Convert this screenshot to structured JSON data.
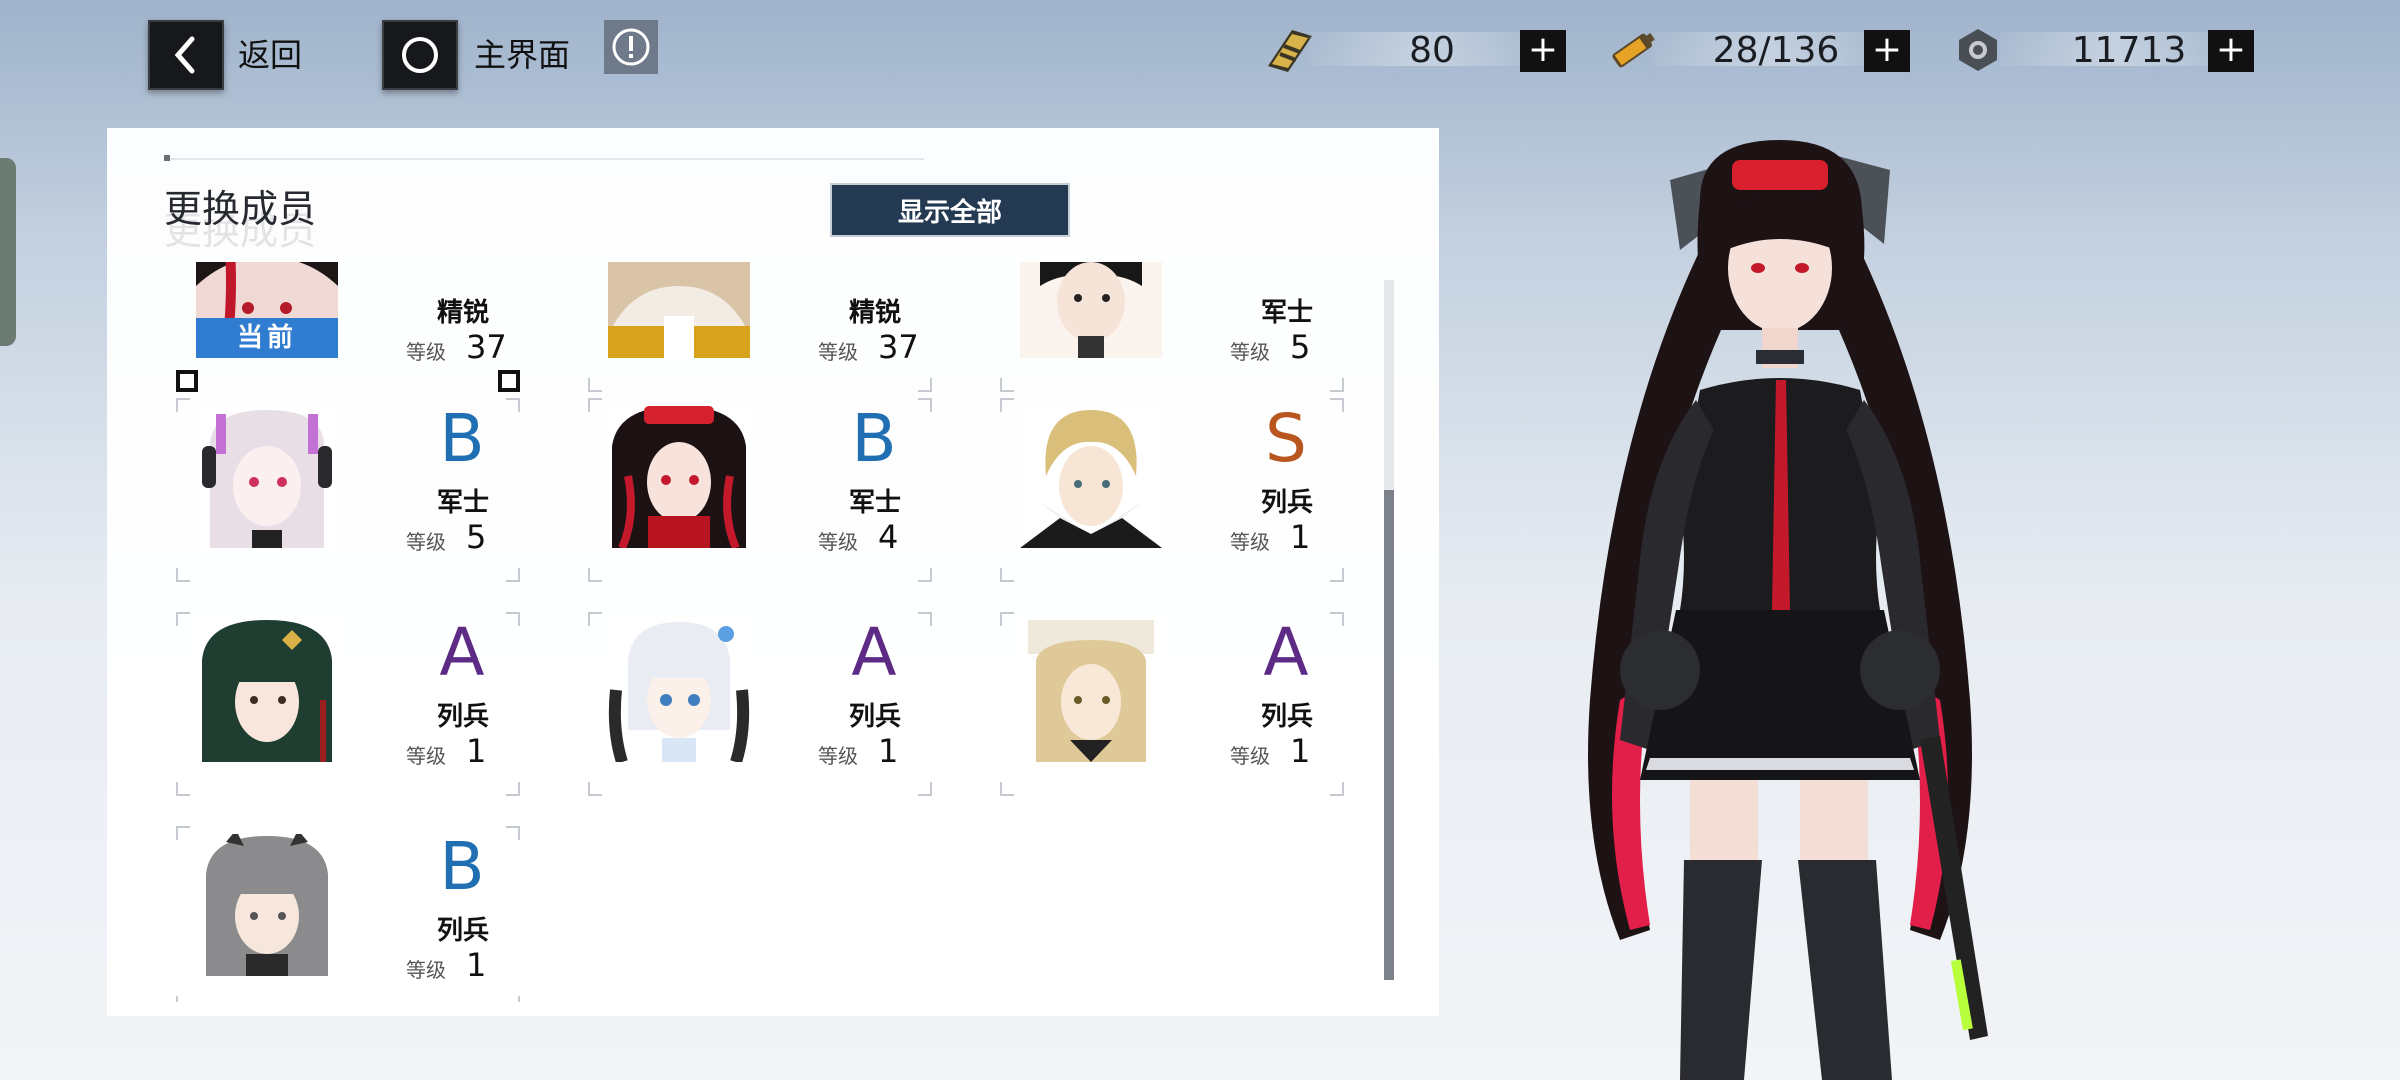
{
  "topbar": {
    "back_label": "返回",
    "home_label": "主界面",
    "resources": [
      {
        "icon": "ticket-icon",
        "value": "80"
      },
      {
        "icon": "battery-icon",
        "value": "28/136"
      },
      {
        "icon": "nut-icon",
        "value": "11713"
      }
    ],
    "plus_label": "+"
  },
  "panel": {
    "title": "更换成员",
    "show_all_label": "显示全部",
    "current_tag": "当前",
    "level_key": "等级"
  },
  "members": [
    {
      "rank": "",
      "grade": "精锐",
      "level": "37",
      "current": true
    },
    {
      "rank": "",
      "grade": "精锐",
      "level": "37",
      "current": false
    },
    {
      "rank": "",
      "grade": "军士",
      "level": "5",
      "current": false
    },
    {
      "rank": "B",
      "grade": "军士",
      "level": "5",
      "current": false
    },
    {
      "rank": "B",
      "grade": "军士",
      "level": "4",
      "current": false
    },
    {
      "rank": "S",
      "grade": "列兵",
      "level": "1",
      "current": false
    },
    {
      "rank": "A",
      "grade": "列兵",
      "level": "1",
      "current": false
    },
    {
      "rank": "A",
      "grade": "列兵",
      "level": "1",
      "current": false
    },
    {
      "rank": "A",
      "grade": "列兵",
      "level": "1",
      "current": false
    },
    {
      "rank": "B",
      "grade": "列兵",
      "level": "1",
      "current": false
    }
  ],
  "rank_colors": {
    "S": "#b8561f",
    "A": "#5d2a86",
    "B": "#1f6fb2"
  },
  "accent": "#243a52",
  "current_color": "#2f7cd0"
}
